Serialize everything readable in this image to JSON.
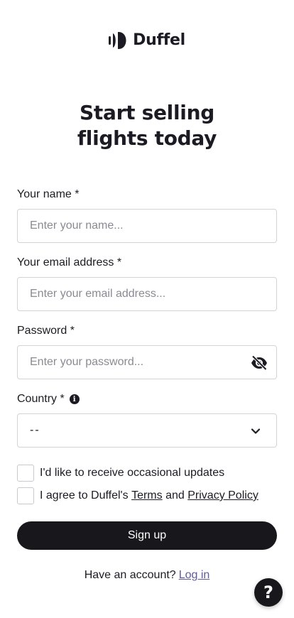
{
  "brand": {
    "name": "Duffel"
  },
  "heading": {
    "line1": "Start selling",
    "line2": "flights today"
  },
  "form": {
    "name": {
      "label": "Your name *",
      "placeholder": "Enter your name..."
    },
    "email": {
      "label": "Your email address *",
      "placeholder": "Enter your email address..."
    },
    "password": {
      "label": "Password *",
      "placeholder": "Enter your password..."
    },
    "country": {
      "label": "Country *",
      "value": "--"
    },
    "updates": {
      "label": "I'd like to receive occasional updates"
    },
    "agree": {
      "prefix": "I agree to Duffel's",
      "terms": "Terms",
      "and": "and",
      "privacy": "Privacy Policy"
    },
    "submit_label": "Sign up"
  },
  "footer": {
    "prompt": "Have an account?",
    "login": "Log in"
  },
  "help": {
    "label": "?"
  },
  "icons": {
    "logo": "duffel-logo-icon",
    "password_toggle": "eye-slash-icon",
    "country_info": "info-icon",
    "select": "chevron-down-icon"
  },
  "colors": {
    "primary": "#18171c",
    "link": "#5f5a9a",
    "border": "#d2d2d7"
  }
}
